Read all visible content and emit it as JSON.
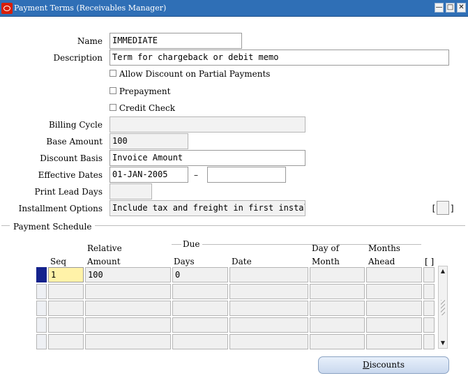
{
  "window": {
    "title": "Payment Terms (Receivables Manager)",
    "controls": [
      "minimize-icon",
      "maximize-icon",
      "close-icon"
    ]
  },
  "header": {
    "name_label": "Name",
    "name_value": "IMMEDIATE",
    "description_label": "Description",
    "description_value": "Term for chargeback or debit memo",
    "allow_discount_label": "Allow Discount on Partial Payments",
    "prepayment_label": "Prepayment",
    "credit_check_label": "Credit Check",
    "billing_cycle_label": "Billing Cycle",
    "billing_cycle_value": "",
    "base_amount_label": "Base Amount",
    "base_amount_value": "100",
    "discount_basis_label": "Discount Basis",
    "discount_basis_value": "Invoice Amount",
    "effective_dates_label": "Effective Dates",
    "effective_from": "01-JAN-2005",
    "effective_dash": "–",
    "effective_to": "",
    "print_lead_days_label": "Print Lead Days",
    "print_lead_days_value": "",
    "installment_options_label": "Installment Options",
    "installment_options_value": "Include tax and freight in first install",
    "dff_open": "[",
    "dff_close": "]"
  },
  "schedule": {
    "section_title": "Payment Schedule",
    "col_seq": "Seq",
    "col_relative_top": "Relative",
    "col_relative_bottom": "Amount",
    "due_group": "Due",
    "col_days": "Days",
    "col_date": "Date",
    "col_day_of_top": "Day of",
    "col_day_of_bottom": "Month",
    "col_months_top": "Months",
    "col_months_bottom": "Ahead",
    "col_dff": "[ ]",
    "rows": [
      {
        "seq": "1",
        "amount": "100",
        "days": "0",
        "date": "",
        "day_of_month": "",
        "months_ahead": ""
      },
      {
        "seq": "",
        "amount": "",
        "days": "",
        "date": "",
        "day_of_month": "",
        "months_ahead": ""
      },
      {
        "seq": "",
        "amount": "",
        "days": "",
        "date": "",
        "day_of_month": "",
        "months_ahead": ""
      },
      {
        "seq": "",
        "amount": "",
        "days": "",
        "date": "",
        "day_of_month": "",
        "months_ahead": ""
      },
      {
        "seq": "",
        "amount": "",
        "days": "",
        "date": "",
        "day_of_month": "",
        "months_ahead": ""
      }
    ]
  },
  "buttons": {
    "discounts_accel": "D",
    "discounts_rest": "iscounts"
  },
  "colors": {
    "titlebar": "#2f6fb6",
    "current_record": "#14228c",
    "active_cell": "#fff2a8"
  }
}
